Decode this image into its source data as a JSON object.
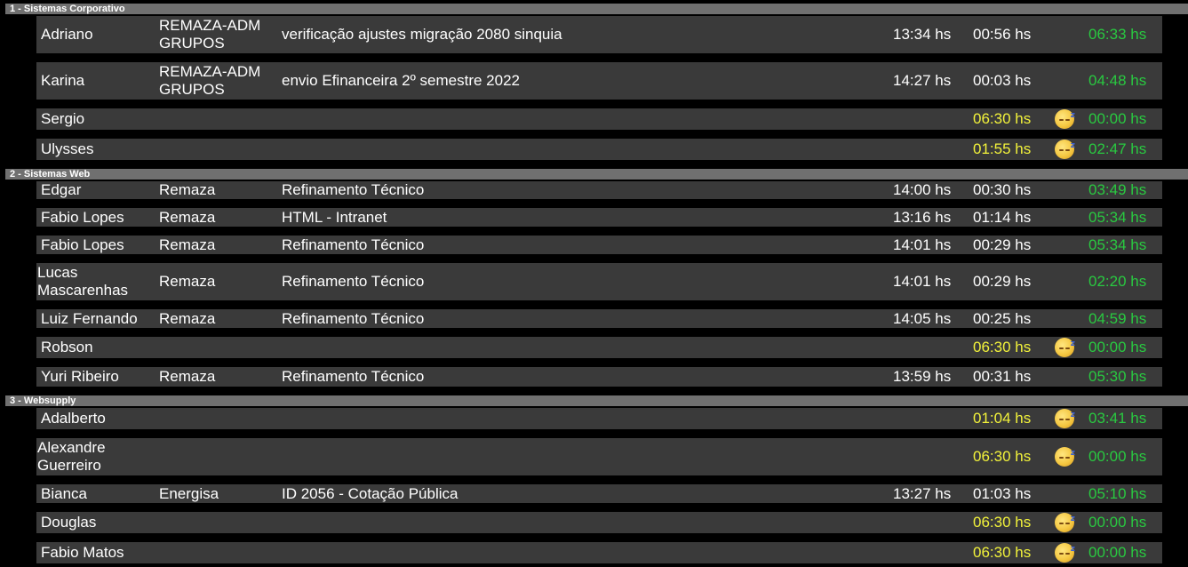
{
  "colors": {
    "remaining": "#29c940",
    "idle_time": "#f2f23a",
    "row_bg": "#3a3a3a",
    "header_bg": "#707070"
  },
  "sections": [
    {
      "title": "1 - Sistemas Corporativo",
      "rows": [
        {
          "name": "Adriano",
          "client": "REMAZA-ADM GRUPOS",
          "task": "verificação ajustes migração 2080 sinquia",
          "start": "13:34 hs",
          "duration": "00:56 hs",
          "remaining": "06:33 hs"
        },
        {
          "name": "Karina",
          "client": "REMAZA-ADM GRUPOS",
          "task": "envio Efinanceira 2º semestre 2022",
          "start": "14:27 hs",
          "duration": "00:03 hs",
          "remaining": "04:48 hs"
        },
        {
          "name": "Sergio",
          "idle": "06:30 hs",
          "icon": "sleeping-face-icon",
          "remaining": "00:00 hs"
        },
        {
          "name": "Ulysses",
          "idle": "01:55 hs",
          "icon": "sleeping-face-icon",
          "remaining": "02:47 hs"
        }
      ]
    },
    {
      "title": "2 - Sistemas Web",
      "rows": [
        {
          "name": "Edgar",
          "client": "Remaza",
          "task": "Refinamento Técnico",
          "start": "14:00 hs",
          "duration": "00:30 hs",
          "remaining": "03:49 hs"
        },
        {
          "name": "Fabio Lopes",
          "client": "Remaza",
          "task": "HTML - Intranet",
          "start": "13:16 hs",
          "duration": "01:14 hs",
          "remaining": "05:34 hs"
        },
        {
          "name": "Fabio Lopes",
          "client": "Remaza",
          "task": "Refinamento Técnico",
          "start": "14:01 hs",
          "duration": "00:29 hs",
          "remaining": "05:34 hs"
        },
        {
          "name": "Lucas Mascarenhas",
          "client": "Remaza",
          "task": "Refinamento Técnico",
          "start": "14:01 hs",
          "duration": "00:29 hs",
          "remaining": "02:20 hs"
        },
        {
          "name": "Luiz Fernando",
          "client": "Remaza",
          "task": "Refinamento Técnico",
          "start": "14:05 hs",
          "duration": "00:25 hs",
          "remaining": "04:59 hs"
        },
        {
          "name": "Robson",
          "idle": "06:30 hs",
          "icon": "sleeping-face-icon",
          "remaining": "00:00 hs"
        },
        {
          "name": "Yuri Ribeiro",
          "client": "Remaza",
          "task": "Refinamento Técnico",
          "start": "13:59 hs",
          "duration": "00:31 hs",
          "remaining": "05:30 hs"
        }
      ]
    },
    {
      "title": "3 - Websupply",
      "rows": [
        {
          "name": "Adalberto",
          "idle": "01:04 hs",
          "icon": "sleeping-face-icon",
          "remaining": "03:41 hs"
        },
        {
          "name": "Alexandre Guerreiro",
          "idle": "06:30 hs",
          "icon": "sleeping-face-icon",
          "remaining": "00:00 hs"
        },
        {
          "name": "Bianca",
          "client": "Energisa",
          "task": "ID 2056 - Cotação Pública",
          "start": "13:27 hs",
          "duration": "01:03 hs",
          "remaining": "05:10 hs"
        },
        {
          "name": "Douglas",
          "idle": "06:30 hs",
          "icon": "sleeping-face-icon",
          "remaining": "00:00 hs"
        },
        {
          "name": "Fabio Matos",
          "idle": "06:30 hs",
          "icon": "sleeping-face-icon",
          "remaining": "00:00 hs"
        }
      ]
    }
  ]
}
